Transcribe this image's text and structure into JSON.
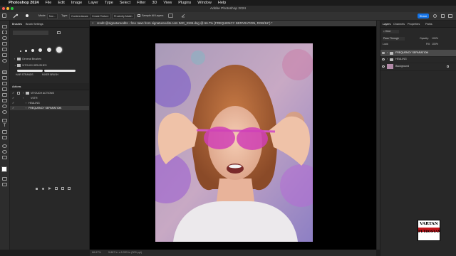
{
  "menubar": {
    "app": "Photoshop 2024",
    "items": [
      "File",
      "Edit",
      "Image",
      "Layer",
      "Type",
      "Select",
      "Filter",
      "3D",
      "View",
      "Plugins",
      "Window",
      "Help"
    ]
  },
  "window": {
    "title": "Adobe Photoshop 2024"
  },
  "options": {
    "mode_label": "Mode:",
    "mode_value": "Nor...",
    "type_label": "Type:",
    "type_value": "Content-Aware",
    "create_texture": "Create Texture",
    "proximity_match": "Proximity Match",
    "sample_all_layers": "Sample All Layers",
    "share": "Share"
  },
  "brushes_panel": {
    "tabs": [
      "Brushes",
      "Brush Settings"
    ],
    "presets": [
      "General Brushes",
      "VITOUCH BRUSHES"
    ],
    "brush_names": [
      "HAIR STRANDS",
      "MIXER BRUSH"
    ]
  },
  "actions_panel": {
    "tab": "Actions",
    "items": [
      "VITOUCH ACTIONS",
      "VSTR",
      "HEALING",
      "FREQUENCY SEPARATION"
    ]
  },
  "document": {
    "tab": "credit @signatureedits - free raws from signatureedits.com IMG_3345.dng @ 66.7% (FREQUENCY SEPARATION, RGB/16*) *",
    "zoom": "66.67%",
    "doc_info": "5.887 in x 8.333 in (300 ppi)"
  },
  "layers_panel": {
    "tabs": [
      "Layers",
      "Channels",
      "Properties",
      "Paths"
    ],
    "kind_label": "Kind",
    "blend_mode": "Pass Through",
    "opacity_label": "Opacity:",
    "opacity": "100%",
    "lock_label": "Lock:",
    "fill_label": "Fill:",
    "fill": "100%",
    "layers": [
      {
        "name": "FREQUENCY SEPARATION",
        "type": "group",
        "selected": true
      },
      {
        "name": "HEALING",
        "type": "group",
        "selected": false
      },
      {
        "name": "Background",
        "type": "image",
        "selected": false
      }
    ]
  },
  "watermark": {
    "line1": "VARTAN",
    "line2": "PETROSYAN"
  },
  "colors": {
    "accent": "#1473e6",
    "panel": "#282828",
    "selection": "#4a4a4a",
    "logo_red": "#c4161c"
  }
}
